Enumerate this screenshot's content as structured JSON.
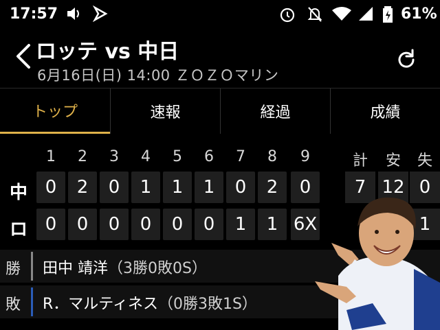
{
  "status": {
    "time": "17:57",
    "battery": "61%"
  },
  "header": {
    "title": "ロッテ vs 中日",
    "subtitle": "6月16日(日) 14:00 ＺＯＺＯマリン"
  },
  "tabs": [
    {
      "label": "トップ",
      "active": true
    },
    {
      "label": "速報",
      "active": false
    },
    {
      "label": "経過",
      "active": false
    },
    {
      "label": "成績",
      "active": false
    }
  ],
  "scoreboard": {
    "innings": [
      "1",
      "2",
      "3",
      "4",
      "5",
      "6",
      "7",
      "8",
      "9"
    ],
    "totals_headers": [
      "計",
      "安",
      "失"
    ],
    "teams": [
      {
        "name": "中",
        "runs": [
          "0",
          "2",
          "0",
          "1",
          "1",
          "1",
          "0",
          "2",
          "0"
        ],
        "totals": [
          "7",
          "12",
          "0"
        ]
      },
      {
        "name": "ロ",
        "runs": [
          "0",
          "0",
          "0",
          "0",
          "0",
          "0",
          "1",
          "1",
          "6X"
        ],
        "totals": [
          "",
          "",
          "1"
        ]
      }
    ]
  },
  "pitchers": {
    "win": {
      "label": "勝",
      "name": "田中 靖洋",
      "stats": "（3勝0敗0S）",
      "color": "#888888"
    },
    "loss": {
      "label": "敗",
      "name": "R．マルティネス",
      "stats": "（0勝3敗1S）",
      "color": "#2a5cb8"
    }
  },
  "colors": {
    "accent": "#e0b24a"
  }
}
